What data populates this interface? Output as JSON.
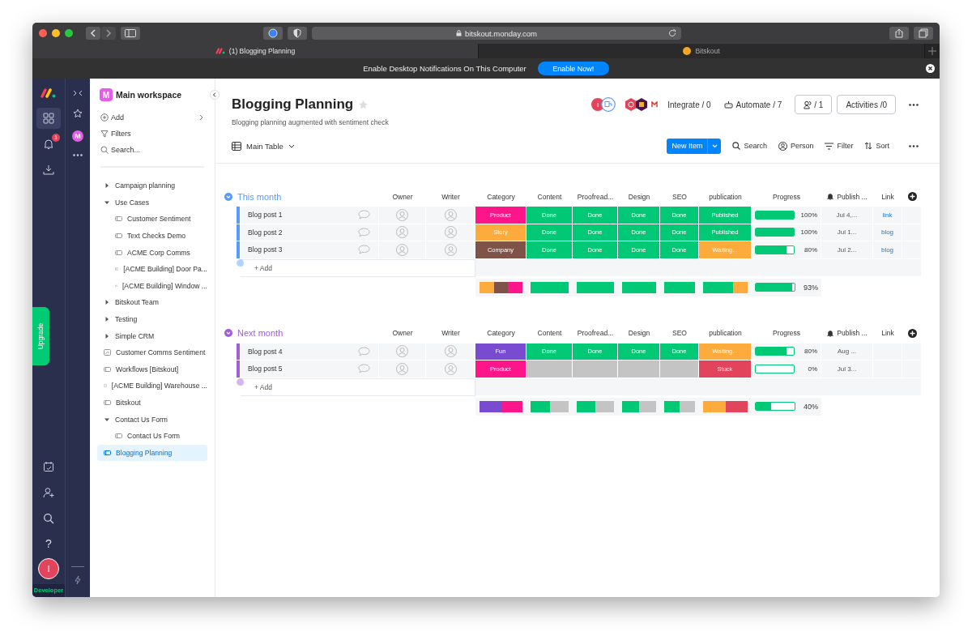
{
  "browser": {
    "url": "bitskout.monday.com",
    "tabs": [
      {
        "title": "(1) Blogging Planning",
        "selected": true,
        "kind": "monday"
      },
      {
        "title": "Bitskout",
        "selected": false,
        "kind": "bitskout"
      }
    ]
  },
  "notification": {
    "text": "Enable Desktop Notifications On This Computer",
    "button": "Enable Now!"
  },
  "rail": {
    "notifications": "1",
    "upgrade": "Upgrade",
    "help": "?",
    "avatar": "I",
    "plan": "Developer"
  },
  "workspace": {
    "rail_avatar": "M",
    "avatar": "M",
    "name": "Main workspace",
    "actions": [
      {
        "kind": "add",
        "label": "Add"
      },
      {
        "kind": "filter",
        "label": "Filters"
      },
      {
        "kind": "search",
        "label": "Search..."
      }
    ],
    "tree": [
      {
        "label": "Campaign planning",
        "kind": "folder",
        "expanded": false,
        "selected": false
      },
      {
        "label": "Use Cases",
        "kind": "folder",
        "expanded": true,
        "selected": false,
        "children": [
          {
            "label": "Customer Sentiment",
            "kind": "board",
            "selected": false
          },
          {
            "label": "Text Checks Demo",
            "kind": "board",
            "selected": false
          },
          {
            "label": "ACME Corp Comms",
            "kind": "board",
            "selected": false
          },
          {
            "label": "[ACME Building] Door Pa...",
            "kind": "board",
            "selected": false
          },
          {
            "label": "[ACME Building] Window ...",
            "kind": "board",
            "selected": false
          }
        ]
      },
      {
        "label": "Bitskout Team",
        "kind": "folder",
        "expanded": false,
        "selected": false
      },
      {
        "label": "Testing",
        "kind": "folder",
        "expanded": false,
        "selected": false
      },
      {
        "label": "Simple CRM",
        "kind": "folder",
        "expanded": false,
        "selected": false
      },
      {
        "label": "Customer Comms Sentiment",
        "kind": "dashboard",
        "selected": false
      },
      {
        "label": "Workflows [Bitskout]",
        "kind": "board",
        "selected": false
      },
      {
        "label": "[ACME Building] Warehouse ...",
        "kind": "dashboard",
        "selected": false
      },
      {
        "label": "Bitskout",
        "kind": "board",
        "selected": false
      },
      {
        "label": "Contact Us Form",
        "kind": "folder",
        "expanded": true,
        "selected": false,
        "children": [
          {
            "label": "Contact Us Form",
            "kind": "board",
            "selected": false
          }
        ]
      },
      {
        "label": "Blogging Planning",
        "kind": "board",
        "selected": true
      }
    ]
  },
  "board": {
    "title": "Blogging Planning",
    "description": "Blogging planning augmented with sentiment check",
    "avatar": "I",
    "integrate": "Integrate / 0",
    "automate": "Automate / 7",
    "members": "/ 1",
    "activities": "Activities /0",
    "view": "Main Table",
    "new_item": "New Item",
    "tools": [
      {
        "kind": "search",
        "label": "Search"
      },
      {
        "kind": "person",
        "label": "Person"
      },
      {
        "kind": "filter",
        "label": "Filter"
      },
      {
        "kind": "sort",
        "label": "Sort"
      }
    ]
  },
  "groups": [
    {
      "title": "This month",
      "color": "#579bfc",
      "columns": [
        "Owner",
        "Writer",
        "Category",
        "Content",
        "Proofread...",
        "Design",
        "SEO",
        "publication",
        "Progress",
        "Publish ...",
        "Link"
      ],
      "add": "+ Add",
      "rows": [
        {
          "name": "Blog post 1",
          "category": {
            "label": "Product",
            "color": "#ff158a"
          },
          "statuses": [
            {
              "label": "Done",
              "color": "#00c875"
            },
            {
              "label": "Done",
              "color": "#00c875"
            },
            {
              "label": "Done",
              "color": "#00c875"
            },
            {
              "label": "Done",
              "color": "#00c875"
            }
          ],
          "publication": {
            "label": "Published",
            "color": "#00c875"
          },
          "progress": {
            "level": 1,
            "reading": "100%"
          },
          "date": "Jul 4,...",
          "link": "link"
        },
        {
          "name": "Blog post 2",
          "category": {
            "label": "Story",
            "color": "#fdab3d"
          },
          "statuses": [
            {
              "label": "Done",
              "color": "#00c875"
            },
            {
              "label": "Done",
              "color": "#00c875"
            },
            {
              "label": "Done",
              "color": "#00c875"
            },
            {
              "label": "Done",
              "color": "#00c875"
            }
          ],
          "publication": {
            "label": "Published",
            "color": "#00c875"
          },
          "progress": {
            "level": 1,
            "reading": "100%"
          },
          "date": "Jul 1...",
          "link": "blog"
        },
        {
          "name": "Blog post 3",
          "category": {
            "label": "Company",
            "color": "#7f5347"
          },
          "statuses": [
            {
              "label": "Done",
              "color": "#00c875"
            },
            {
              "label": "Done",
              "color": "#00c875"
            },
            {
              "label": "Done",
              "color": "#00c875"
            },
            {
              "label": "Done",
              "color": "#00c875"
            }
          ],
          "publication": {
            "label": "Waiting...",
            "color": "#fdab3d"
          },
          "progress": {
            "level": 0.8,
            "reading": "80%"
          },
          "date": "Jul 2...",
          "link": "blog"
        }
      ],
      "summary": {
        "bars": [
          [
            {
              "color": "#fdab3d"
            },
            {
              "color": "#7f5347"
            },
            {
              "color": "#ff158a"
            }
          ],
          [
            {
              "color": "#00c875"
            }
          ],
          [
            {
              "color": "#00c875"
            }
          ],
          [
            {
              "color": "#00c875"
            }
          ],
          [
            {
              "color": "#00c875"
            }
          ],
          [
            {
              "color": "#00c875"
            },
            {
              "color": "#00c875"
            },
            {
              "color": "#fdab3d"
            }
          ]
        ],
        "progress": {
          "level": 0.93,
          "reading": "93%"
        }
      }
    },
    {
      "title": "Next month",
      "color": "#a25ddc",
      "columns": [
        "Owner",
        "Writer",
        "Category",
        "Content",
        "Proofread...",
        "Design",
        "SEO",
        "publication",
        "Progress",
        "Publish ...",
        "Link"
      ],
      "add": "+ Add",
      "rows": [
        {
          "name": "Blog post 4",
          "category": {
            "label": "Fun",
            "color": "#784bd1"
          },
          "statuses": [
            {
              "label": "Done",
              "color": "#00c875"
            },
            {
              "label": "Done",
              "color": "#00c875"
            },
            {
              "label": "Done",
              "color": "#00c875"
            },
            {
              "label": "Done",
              "color": "#00c875"
            }
          ],
          "publication": {
            "label": "Waiting...",
            "color": "#fdab3d"
          },
          "progress": {
            "level": 0.8,
            "reading": "80%"
          },
          "date": "Aug ..."
        },
        {
          "name": "Blog post 5",
          "category": {
            "label": "Product",
            "color": "#ff158a"
          },
          "statuses": [
            {
              "color": "#c4c4c4"
            },
            {
              "color": "#c4c4c4"
            },
            {
              "color": "#c4c4c4"
            },
            {
              "color": "#c4c4c4"
            }
          ],
          "publication": {
            "label": "Stuck",
            "color": "#e2445c"
          },
          "progress": {
            "level": 0,
            "reading": "0%"
          },
          "date": "Jul 3..."
        }
      ],
      "summary": {
        "bars": [
          [
            {
              "color": "#784bd1"
            },
            {
              "color": "#ff158a"
            }
          ],
          [
            {
              "color": "#00c875"
            },
            {
              "color": "#c4c4c4"
            }
          ],
          [
            {
              "color": "#00c875"
            },
            {
              "color": "#c4c4c4"
            }
          ],
          [
            {
              "color": "#00c875"
            },
            {
              "color": "#c4c4c4"
            }
          ],
          [
            {
              "color": "#00c875"
            },
            {
              "color": "#c4c4c4"
            }
          ],
          [
            {
              "color": "#fdab3d"
            },
            {
              "color": "#e2445c"
            }
          ]
        ],
        "progress": {
          "level": 0.4,
          "reading": "40%"
        }
      }
    }
  ]
}
